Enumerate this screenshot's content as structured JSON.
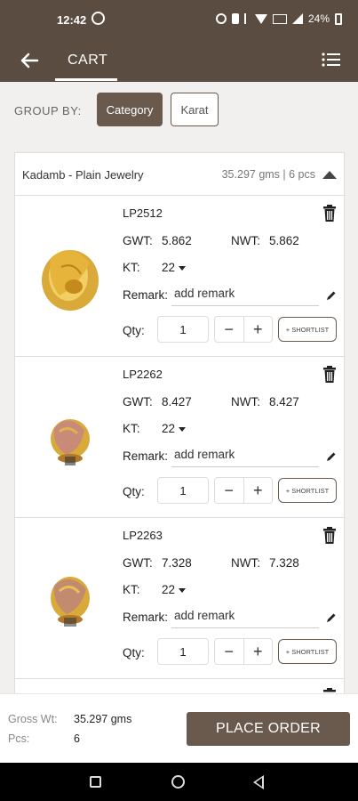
{
  "status": {
    "time": "12:42",
    "battery": "24%"
  },
  "app_bar": {
    "title": "CART",
    "back_icon": "arrow-left-icon",
    "menu_icon": "list-menu-icon"
  },
  "group_by": {
    "label": "GROUP BY:",
    "options": [
      "Category",
      "Karat"
    ],
    "selected": "Category"
  },
  "group": {
    "name": "Kadamb - Plain Jewelry",
    "summary": "35.297 gms | 6 pcs"
  },
  "labels": {
    "gwt": "GWT:",
    "nwt": "NWT:",
    "kt": "KT:",
    "remark": "Remark:",
    "qty": "Qty:",
    "remark_placeholder": "add remark",
    "shortlist": "+ SHORTLIST",
    "minus": "−",
    "plus": "+"
  },
  "items": [
    {
      "code": "LP2512",
      "gwt": "5.862",
      "nwt": "5.862",
      "kt": "22",
      "qty": "1"
    },
    {
      "code": "LP2262",
      "gwt": "8.427",
      "nwt": "8.427",
      "kt": "22",
      "qty": "1"
    },
    {
      "code": "LP2263",
      "gwt": "7.328",
      "nwt": "7.328",
      "kt": "22",
      "qty": "1"
    }
  ],
  "summary": {
    "gross_label": "Gross Wt:",
    "gross_value": "35.297 gms",
    "pcs_label": "Pcs:",
    "pcs_value": "6"
  },
  "place_order": "PLACE ORDER",
  "colors": {
    "brand": "#5b4c41",
    "button": "#6a5a4e"
  }
}
